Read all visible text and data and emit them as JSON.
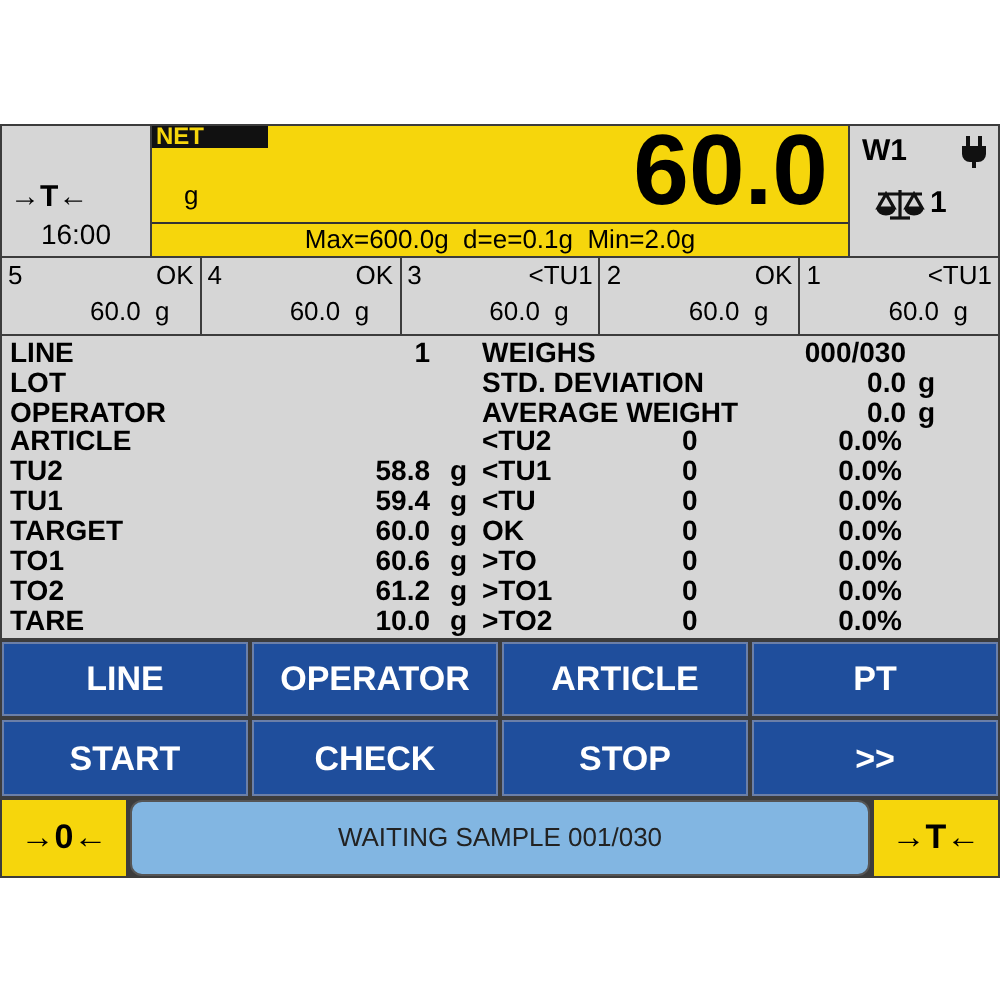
{
  "tare_indicator": "→T←",
  "time": "16:00",
  "display": {
    "mode": "NET",
    "unit": "g",
    "value": "60.0",
    "specs": "Max=600.0g  d=e=0.1g  Min=2.0g"
  },
  "scale": {
    "name": "W1",
    "number": "1"
  },
  "slots": [
    {
      "index": "5",
      "status": "OK",
      "weight": "60.0",
      "unit": "g"
    },
    {
      "index": "4",
      "status": "OK",
      "weight": "60.0",
      "unit": "g"
    },
    {
      "index": "3",
      "status": "<TU1",
      "weight": "60.0",
      "unit": "g"
    },
    {
      "index": "2",
      "status": "OK",
      "weight": "60.0",
      "unit": "g"
    },
    {
      "index": "1",
      "status": "<TU1",
      "weight": "60.0",
      "unit": "g"
    }
  ],
  "info": [
    {
      "label": "LINE",
      "value": "1"
    },
    {
      "label": "LOT"
    },
    {
      "label": "OPERATOR"
    },
    {
      "label": "ARTICLE"
    },
    {
      "label": "TU2",
      "value": "58.8",
      "unit": "g"
    },
    {
      "label": "TU1",
      "value": "59.4",
      "unit": "g"
    },
    {
      "label": "TARGET",
      "value": "60.0",
      "unit": "g"
    },
    {
      "label": "TO1",
      "value": "60.6",
      "unit": "g"
    },
    {
      "label": "TO2",
      "value": "61.2",
      "unit": "g"
    },
    {
      "label": "TARE",
      "value": "10.0",
      "unit": "g"
    }
  ],
  "stats": [
    {
      "label": "WEIGHS",
      "value": "000/030"
    },
    {
      "label": "STD. DEVIATION",
      "value": "0.0",
      "unit": "g"
    },
    {
      "label": "AVERAGE WEIGHT",
      "value": "0.0",
      "unit": "g"
    }
  ],
  "counts": [
    {
      "label": "<TU2",
      "count": "0",
      "percent": "0.0%"
    },
    {
      "label": "<TU1",
      "count": "0",
      "percent": "0.0%"
    },
    {
      "label": "<TU",
      "count": "0",
      "percent": "0.0%"
    },
    {
      "label": "OK",
      "count": "0",
      "percent": "0.0%"
    },
    {
      "label": ">TO",
      "count": "0",
      "percent": "0.0%"
    },
    {
      "label": ">TO1",
      "count": "0",
      "percent": "0.0%"
    },
    {
      "label": ">TO2",
      "count": "0",
      "percent": "0.0%"
    }
  ],
  "buttons": [
    [
      "LINE",
      "OPERATOR",
      "ARTICLE",
      "PT"
    ],
    [
      "START",
      "CHECK",
      "STOP",
      ">>"
    ]
  ],
  "zero_button": "→0←",
  "status": "WAITING SAMPLE 001/030",
  "tare_button": "→T←"
}
